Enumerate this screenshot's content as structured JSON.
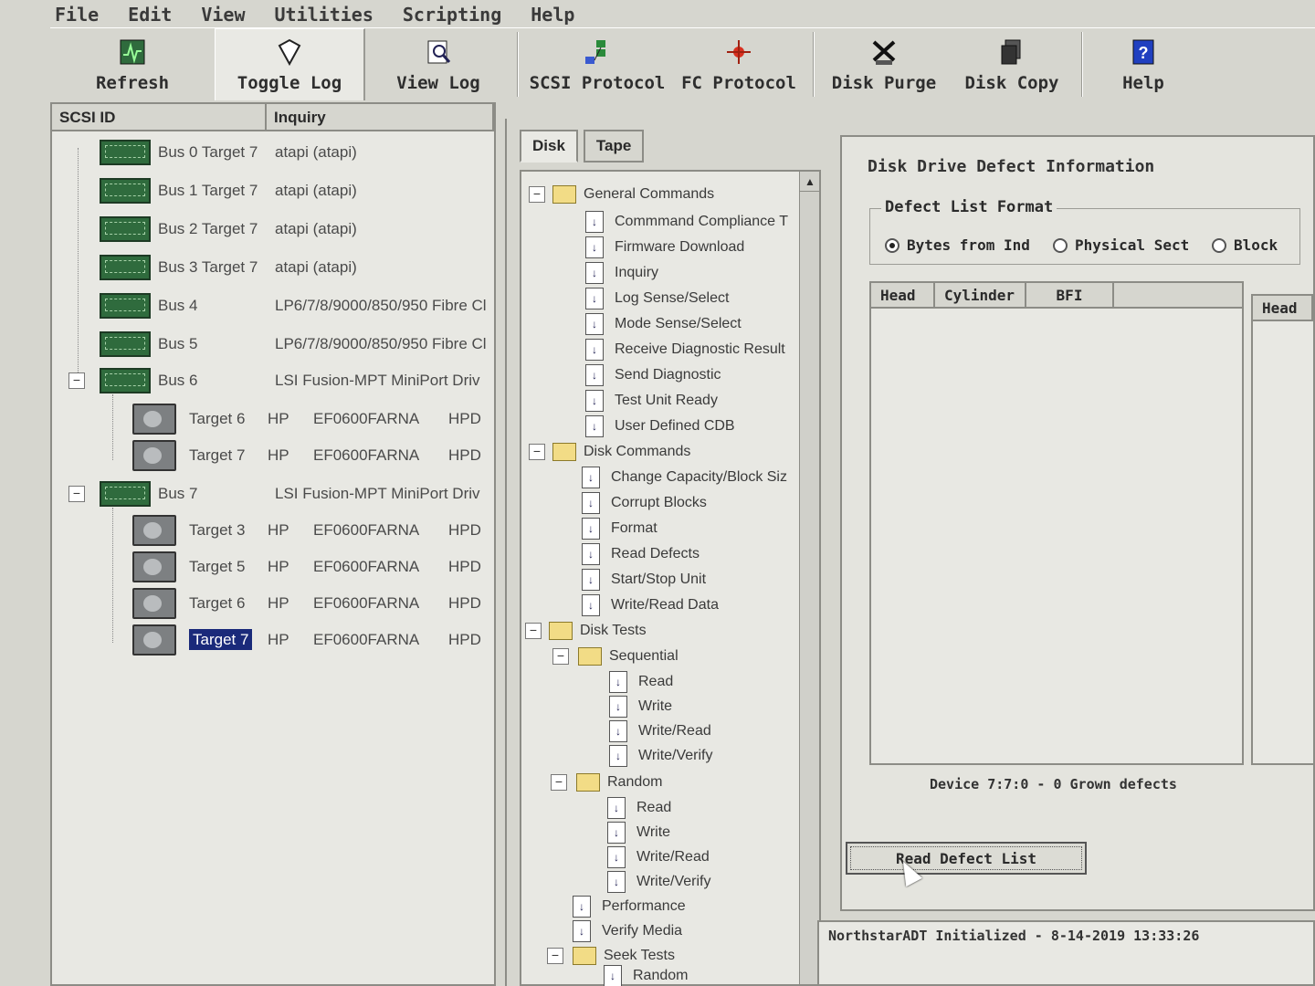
{
  "menu": [
    "File",
    "Edit",
    "View",
    "Utilities",
    "Scripting",
    "Help"
  ],
  "toolbar": {
    "refresh": "Refresh",
    "toggle_log": "Toggle Log",
    "view_log": "View Log",
    "scsi_protocol": "SCSI Protocol",
    "fc_protocol": "FC Protocol",
    "disk_purge": "Disk Purge",
    "disk_copy": "Disk Copy",
    "help": "Help"
  },
  "left": {
    "col_scsi_id": "SCSI ID",
    "col_inquiry": "Inquiry",
    "buses": [
      {
        "id": "Bus 0 Target 7",
        "inq": "atapi (atapi)"
      },
      {
        "id": "Bus 1 Target 7",
        "inq": "atapi (atapi)"
      },
      {
        "id": "Bus 2 Target 7",
        "inq": "atapi (atapi)"
      },
      {
        "id": "Bus 3 Target 7",
        "inq": "atapi (atapi)"
      },
      {
        "id": "Bus 4",
        "inq": "LP6/7/8/9000/850/950 Fibre Cl"
      },
      {
        "id": "Bus 5",
        "inq": "LP6/7/8/9000/850/950 Fibre Cl"
      },
      {
        "id": "Bus 6",
        "inq": "LSI Fusion-MPT MiniPort Driv"
      },
      {
        "id": "Bus 7",
        "inq": "LSI Fusion-MPT MiniPort Driv"
      }
    ],
    "bus6_targets": [
      {
        "id": "Target 6",
        "vendor": "HP",
        "model": "EF0600FARNA",
        "rev": "HPD"
      },
      {
        "id": "Target 7",
        "vendor": "HP",
        "model": "EF0600FARNA",
        "rev": "HPD"
      }
    ],
    "bus7_targets": [
      {
        "id": "Target 3",
        "vendor": "HP",
        "model": "EF0600FARNA",
        "rev": "HPD"
      },
      {
        "id": "Target 5",
        "vendor": "HP",
        "model": "EF0600FARNA",
        "rev": "HPD"
      },
      {
        "id": "Target 6",
        "vendor": "HP",
        "model": "EF0600FARNA",
        "rev": "HPD"
      },
      {
        "id": "Target 7",
        "vendor": "HP",
        "model": "EF0600FARNA",
        "rev": "HPD"
      }
    ]
  },
  "mid": {
    "tab_disk": "Disk",
    "tab_tape": "Tape",
    "general": "General Commands",
    "general_items": [
      "Commmand Compliance T",
      "Firmware Download",
      "Inquiry",
      "Log Sense/Select",
      "Mode Sense/Select",
      "Receive Diagnostic Result",
      "Send Diagnostic",
      "Test Unit Ready",
      "User Defined CDB"
    ],
    "disk_cmds": "Disk Commands",
    "disk_items": [
      "Change Capacity/Block Siz",
      "Corrupt Blocks",
      "Format",
      "Read Defects",
      "Start/Stop Unit",
      "Write/Read Data"
    ],
    "disk_tests": "Disk Tests",
    "sequential": "Sequential",
    "seq_items": [
      "Read",
      "Write",
      "Write/Read",
      "Write/Verify"
    ],
    "random": "Random",
    "rand_items": [
      "Read",
      "Write",
      "Write/Read",
      "Write/Verify"
    ],
    "performance": "Performance",
    "verify_media": "Verify Media",
    "seek_tests": "Seek Tests",
    "seek_random": "Random"
  },
  "right": {
    "title": "Disk Drive Defect Information",
    "group_label": "Defect List Format",
    "radio_bytes": "Bytes from Ind",
    "radio_physical": "Physical Sect",
    "radio_block": "Block",
    "col_head": "Head",
    "col_cylinder": "Cylinder",
    "col_bfi": "BFI",
    "col_head2": "Head",
    "status": "Device 7:7:0 - 0  Grown defects",
    "read_button": "Read Defect List"
  },
  "log": {
    "line": "NorthstarADT Initialized - 8-14-2019  13:33:26"
  }
}
